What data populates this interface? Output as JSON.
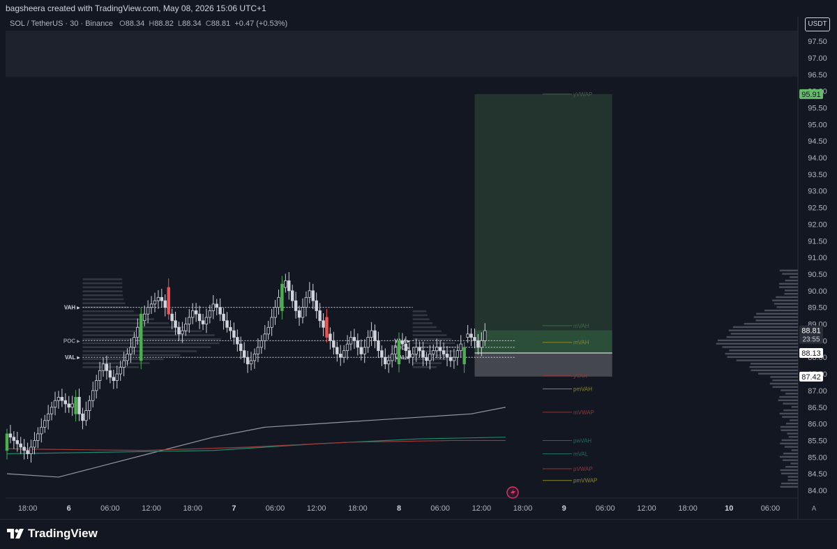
{
  "header": {
    "attribution": "bagsheera created with TradingView.com, May 08, 2026 15:06 UTC+1"
  },
  "legend": {
    "symbol": "SOL / TetherUS · 30 · Binance",
    "open_label": "O",
    "open": "88.34",
    "high_label": "H",
    "high": "88.82",
    "low_label": "L",
    "low": "88.34",
    "close_label": "C",
    "close": "88.81",
    "change": "+0.47 (+0.53%)"
  },
  "currency_button": "USDT",
  "brand": {
    "name": "TradingView",
    "icon": "tradingview-logo-icon"
  },
  "auto_scale_label": "A",
  "colors": {
    "background": "#131722",
    "up": "#4caf50",
    "down": "#ef5350",
    "neutral_candle": "#d1d4dc",
    "target_zone": "#26392f",
    "stop_zone": "#4a4c55",
    "price_tag_green": "#66bb6a"
  },
  "chart_data": {
    "type": "candlestick",
    "symbol": "SOL / TetherUS",
    "timeframe": "30",
    "exchange": "Binance",
    "ylim": [
      83.8,
      98.1
    ],
    "y_ticks": [
      "97.50",
      "97.00",
      "96.50",
      "96.00",
      "95.50",
      "95.00",
      "94.50",
      "94.00",
      "93.50",
      "93.00",
      "92.50",
      "92.00",
      "91.50",
      "91.00",
      "90.50",
      "90.00",
      "89.50",
      "89.00",
      "88.50",
      "88.00",
      "87.50",
      "87.00",
      "86.50",
      "86.00",
      "85.50",
      "85.00",
      "84.50",
      "84.00"
    ],
    "x_ticks": [
      {
        "label": "18:00",
        "bar": 6,
        "bold": false
      },
      {
        "label": "6",
        "bar": 18,
        "bold": true
      },
      {
        "label": "06:00",
        "bar": 30,
        "bold": false
      },
      {
        "label": "12:00",
        "bar": 42,
        "bold": false
      },
      {
        "label": "18:00",
        "bar": 54,
        "bold": false
      },
      {
        "label": "7",
        "bar": 66,
        "bold": true
      },
      {
        "label": "06:00",
        "bar": 78,
        "bold": false
      },
      {
        "label": "12:00",
        "bar": 90,
        "bold": false
      },
      {
        "label": "18:00",
        "bar": 102,
        "bold": false
      },
      {
        "label": "8",
        "bar": 114,
        "bold": true
      },
      {
        "label": "06:00",
        "bar": 126,
        "bold": false
      },
      {
        "label": "12:00",
        "bar": 138,
        "bold": false
      },
      {
        "label": "18:00",
        "bar": 150,
        "bold": false
      },
      {
        "label": "9",
        "bar": 162,
        "bold": true
      },
      {
        "label": "06:00",
        "bar": 174,
        "bold": false
      },
      {
        "label": "12:00",
        "bar": 186,
        "bold": false
      },
      {
        "label": "18:00",
        "bar": 198,
        "bold": false
      },
      {
        "label": "10",
        "bar": 210,
        "bold": true
      },
      {
        "label": "06:00",
        "bar": 222,
        "bold": false
      }
    ],
    "closes": [
      85.7,
      85.6,
      85.5,
      85.4,
      85.3,
      85.2,
      85.1,
      85.3,
      85.5,
      85.7,
      85.9,
      86.1,
      86.3,
      86.5,
      86.7,
      86.8,
      86.7,
      86.6,
      86.5,
      86.6,
      86.8,
      86.3,
      86.1,
      86.4,
      86.7,
      87.0,
      87.3,
      87.6,
      87.8,
      87.6,
      87.4,
      87.3,
      87.5,
      87.7,
      87.9,
      88.1,
      88.3,
      88.6,
      88.9,
      89.1,
      89.3,
      89.5,
      89.6,
      89.7,
      89.8,
      89.7,
      89.5,
      89.3,
      89.1,
      88.9,
      88.7,
      88.8,
      89.0,
      89.2,
      89.4,
      89.3,
      89.1,
      89.0,
      89.2,
      89.4,
      89.6,
      89.5,
      89.3,
      89.1,
      88.9,
      88.8,
      88.6,
      88.4,
      88.2,
      88.0,
      87.8,
      87.9,
      88.1,
      88.3,
      88.5,
      88.7,
      88.9,
      89.2,
      89.5,
      89.8,
      90.1,
      90.3,
      90.0,
      89.7,
      89.4,
      89.2,
      89.5,
      89.8,
      90.0,
      89.7,
      89.4,
      89.1,
      88.9,
      88.7,
      88.5,
      88.3,
      88.1,
      88.0,
      88.2,
      88.4,
      88.6,
      88.5,
      88.3,
      88.1,
      88.3,
      88.6,
      88.8,
      88.5,
      88.2,
      88.0,
      87.8,
      87.9,
      88.1,
      88.3,
      88.5,
      88.4,
      88.2,
      88.0,
      88.1,
      88.3,
      88.2,
      88.0,
      87.9,
      88.1,
      88.2,
      88.3,
      88.2,
      88.1,
      88.0,
      87.9,
      88.0,
      88.2,
      88.4,
      88.6,
      88.7,
      88.6,
      88.5,
      88.3,
      88.5,
      88.8
    ],
    "special_candles": [
      {
        "bar": 0,
        "o": 85.2,
        "c": 85.7,
        "color": "up"
      },
      {
        "bar": 20,
        "o": 86.3,
        "c": 86.8,
        "color": "up"
      },
      {
        "bar": 39,
        "o": 87.9,
        "c": 89.3,
        "color": "up"
      },
      {
        "bar": 47,
        "o": 90.1,
        "c": 89.3,
        "color": "down"
      },
      {
        "bar": 80,
        "o": 89.4,
        "c": 90.2,
        "color": "up"
      },
      {
        "bar": 93,
        "o": 89.2,
        "c": 88.6,
        "color": "down"
      },
      {
        "bar": 114,
        "o": 88.5,
        "c": 87.8,
        "color": "up"
      },
      {
        "bar": 133,
        "o": 87.8,
        "c": 88.3,
        "color": "up"
      }
    ],
    "moving_averages": [
      {
        "color": "#9598a1",
        "points": [
          [
            0,
            84.5
          ],
          [
            15,
            84.4
          ],
          [
            30,
            84.8
          ],
          [
            45,
            85.2
          ],
          [
            60,
            85.6
          ],
          [
            75,
            85.9
          ],
          [
            90,
            86.0
          ],
          [
            105,
            86.1
          ],
          [
            120,
            86.2
          ],
          [
            135,
            86.3
          ],
          [
            145,
            86.5
          ]
        ]
      },
      {
        "color": "#1e8a6e",
        "points": [
          [
            0,
            85.1
          ],
          [
            30,
            85.15
          ],
          [
            60,
            85.2
          ],
          [
            90,
            85.4
          ],
          [
            120,
            85.55
          ],
          [
            145,
            85.6
          ]
        ]
      },
      {
        "color": "#a33a3a",
        "points": [
          [
            0,
            85.25
          ],
          [
            40,
            85.2
          ],
          [
            70,
            85.3
          ],
          [
            100,
            85.45
          ],
          [
            130,
            85.5
          ],
          [
            145,
            85.5
          ]
        ]
      }
    ],
    "volume_profile_day1": {
      "vah_label": "VAH",
      "poc_label": "POC",
      "val_label": "VAL",
      "vah": 89.5,
      "poc": 88.5,
      "val": 88.0
    },
    "volume_profile_day2": {
      "vah_label": "VAH",
      "poc_label": "POC",
      "val_label": "VAL",
      "vah": 88.5,
      "poc": 88.3,
      "val": 88.0
    },
    "position": {
      "target": 95.91,
      "entry": 88.13,
      "stop": 87.42,
      "start_bar": 136,
      "end_bar": 176
    },
    "levels": [
      {
        "label": "yVWAP",
        "price": 95.91,
        "color": "#4a5e52"
      },
      {
        "label": "mVAH",
        "price": 88.95,
        "color": "#3c6b48"
      },
      {
        "label": "mVAH",
        "price": 88.45,
        "color": "#8c8a2a"
      },
      {
        "label": "yVAH",
        "price": 87.45,
        "color": "#8b3a3a"
      },
      {
        "label": "pmVAH",
        "price": 87.05,
        "color": "#8c8a2a"
      },
      {
        "label": "mVWAP",
        "price": 86.35,
        "color": "#8b3a3a"
      },
      {
        "label": "pwVAH",
        "price": 85.5,
        "color": "#1e6e5e"
      },
      {
        "label": "mVAL",
        "price": 85.1,
        "color": "#1e6e5e"
      },
      {
        "label": "pVWAP",
        "price": 84.65,
        "color": "#8b3a3a"
      },
      {
        "label": "pmVWAP",
        "price": 84.3,
        "color": "#8c8a2a"
      }
    ],
    "price_tags": [
      {
        "value": "95.91",
        "kind": "target"
      },
      {
        "value": "88.81",
        "sub": "23:55",
        "kind": "current"
      },
      {
        "value": "88.13",
        "kind": "entry"
      },
      {
        "value": "87.42",
        "kind": "stop"
      }
    ],
    "session_volume_profile_range": [
      84.1,
      90.6
    ]
  }
}
